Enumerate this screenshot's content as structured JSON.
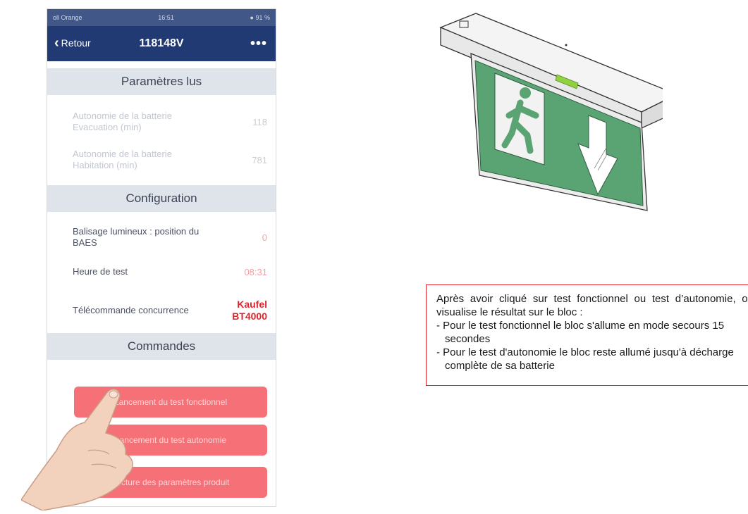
{
  "phone": {
    "status_left": "oll Orange",
    "status_time": "16:51",
    "status_right": "● 91 %",
    "nav": {
      "back_label": "Retour",
      "title": "118148V",
      "more": "•••"
    },
    "sections": {
      "read": "Paramètres lus",
      "config": "Configuration",
      "commands": "Commandes"
    },
    "read_rows": [
      {
        "label": "Autonomie de la batterie Evacuation (min)",
        "value": "118"
      },
      {
        "label": "Autonomie de la batterie Habitation (min)",
        "value": "781"
      }
    ],
    "config_rows": [
      {
        "label": "Balisage lumineux : position du BAES",
        "value": "0"
      },
      {
        "label": "Heure de test",
        "value": "08:31"
      },
      {
        "label": "Télécommande concurrence",
        "value_line1": "Kaufel",
        "value_line2": "BT4000"
      }
    ],
    "commands": [
      "Lancement du test fonctionnel",
      "Lancement du test autonomie",
      "Lecture des paramètres produit"
    ],
    "colors": {
      "nav_bg": "#213a73",
      "command_bg": "#f57177",
      "accent_red": "#e1242e",
      "sign_green": "#5aa373"
    }
  },
  "note": {
    "intro": "Après avoir cliqué sur test fonctionnel ou test d’autonomie, on visualise le résultat sur le bloc :",
    "items": [
      "- Pour le test fonctionnel le bloc s'allume en mode secours 15 secondes",
      "- Pour le test d'autonomie le bloc reste allumé jusqu'à  décharge complète de sa batterie"
    ]
  }
}
